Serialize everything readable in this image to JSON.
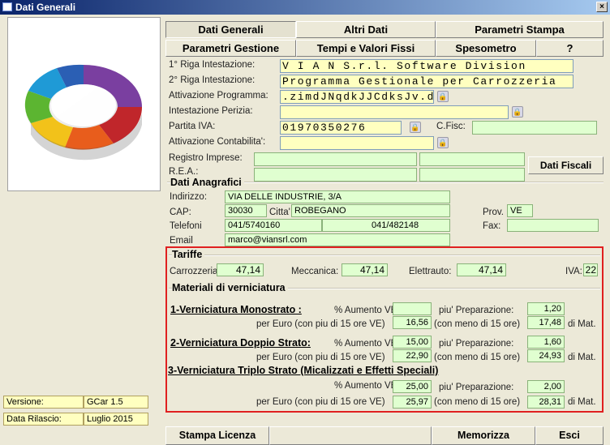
{
  "window": {
    "title": "Dati Generali",
    "close": "×"
  },
  "tabs": {
    "row1": [
      "Dati Generali",
      "Altri Dati",
      "Parametri Stampa"
    ],
    "row2": [
      "Parametri Gestione",
      "Tempi e Valori Fissi",
      "Spesometro",
      "?"
    ]
  },
  "intestazione": {
    "riga1_label": "1° Riga Intestazione:",
    "riga1": "V I A N  S.r.l.  Software Division",
    "riga2_label": "2° Riga Intestazione:",
    "riga2": "Programma Gestionale per Carrozzeria",
    "attivazione_label": "Attivazione Programma:",
    "attivazione": ".zimdJNqdkJJCdksJv.d",
    "perizia_label": "Intestazione Perizia:",
    "perizia": "",
    "piva_label": "Partita IVA:",
    "piva": "01970350276",
    "cfisc_label": "C.Fisc:",
    "cfisc": "",
    "contab_label": "Attivazione Contabilita':",
    "contab": "",
    "registro_label": "Registro Imprese:",
    "rea_label": "R.E.A.:",
    "dati_fiscali": "Dati Fiscali"
  },
  "anagrafici": {
    "title": "Dati Anagrafici",
    "indirizzo_label": "Indirizzo:",
    "indirizzo": "VIA DELLE INDUSTRIE, 3/A",
    "cap_label": "CAP:",
    "cap": "30030",
    "citta_label": "Citta'",
    "citta": "ROBEGANO",
    "prov_label": "Prov.",
    "prov": "VE",
    "tel_label": "Telefoni",
    "tel1": "041/5740160",
    "tel2": "041/482148",
    "fax_label": "Fax:",
    "fax": "",
    "email_label": "Email",
    "email": "marco@viansrl.com"
  },
  "tariffe": {
    "title": "Tariffe",
    "carrozzeria_label": "Carrozzeria:",
    "carrozzeria": "47,14",
    "meccanica_label": "Meccanica:",
    "meccanica": "47,14",
    "elettrauto_label": "Elettrauto:",
    "elettrauto": "47,14",
    "iva_label": "IVA:",
    "iva": "22"
  },
  "verniciatura": {
    "title": "Materiali di verniciatura",
    "aumento_label": "% Aumento VE",
    "prep_label": "piu' Preparazione:",
    "per_euro_label": "per Euro (con piu di 15 ore VE)",
    "meno_label": "(con meno di 15 ore)",
    "di_mat": "di Mat.",
    "mono": {
      "title": "1-Verniciatura Monostrato   :",
      "aumento": "",
      "prep": "1,20",
      "piu15": "16,56",
      "meno15": "17,48"
    },
    "doppio": {
      "title": "2-Verniciatura Doppio Strato:",
      "aumento": "15,00",
      "prep": "1,60",
      "piu15": "22,90",
      "meno15": "24,93"
    },
    "triplo": {
      "title": "3-Verniciatura Triplo Strato (Micalizzati e Effetti Speciali)",
      "aumento": "25,00",
      "prep": "2,00",
      "piu15": "25,97",
      "meno15": "28,31"
    }
  },
  "footer": {
    "versione_label": "Versione:",
    "versione": "GCar 1.5",
    "rilascio_label": "Data Rilascio:",
    "rilascio": "Luglio 2015",
    "stampa": "Stampa Licenza",
    "memorizza": "Memorizza",
    "esci": "Esci"
  },
  "colors": {
    "accent_red": "#e02020",
    "field_yellow": "#ffffc0",
    "field_green": "#e0ffd0",
    "title_blue": "#0a246a"
  }
}
